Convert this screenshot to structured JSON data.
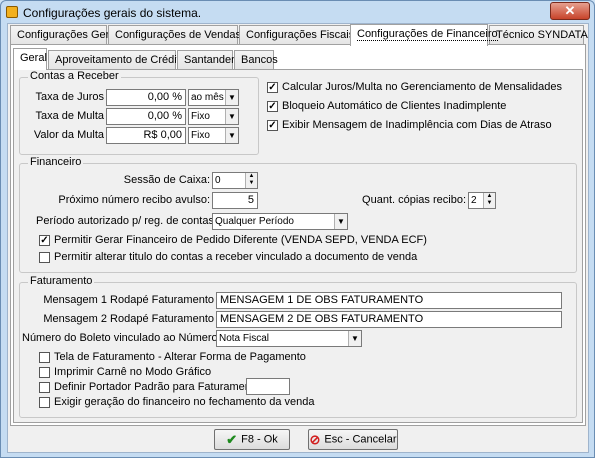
{
  "window": {
    "title": "Configurações gerais do sistema.",
    "close_label": "✕"
  },
  "main_tabs": [
    {
      "label": "Configurações Gerais"
    },
    {
      "label": "Configurações de Vendas"
    },
    {
      "label": "Configurações Fiscais"
    },
    {
      "label": "Configurações de Financeiro"
    },
    {
      "label": "Técnico SYNDATA"
    }
  ],
  "sub_tabs": [
    {
      "label": "Geral"
    },
    {
      "label": "Aproveitamento de Crédito"
    },
    {
      "label": "Santander"
    },
    {
      "label": "Bancos"
    }
  ],
  "contas_receber": {
    "legend": "Contas a Receber",
    "taxa_juros": {
      "label": "Taxa de Juros",
      "value": "0,00 %",
      "unit": "ao mês"
    },
    "taxa_multa": {
      "label": "Taxa de Multa",
      "value": "0,00 %",
      "unit": "Fixo"
    },
    "valor_multa": {
      "label": "Valor da Multa",
      "value": "R$ 0,00",
      "unit": "Fixo"
    }
  },
  "options_right": [
    {
      "label": "Calcular Juros/Multa no Gerenciamento de Mensalidades",
      "checked": true
    },
    {
      "label": "Bloqueio Automático de Clientes Inadimplente",
      "checked": true
    },
    {
      "label": "Exibir Mensagem de Inadimplência com Dias de Atraso",
      "checked": true
    }
  ],
  "financeiro": {
    "legend": "Financeiro",
    "sessao_caixa": {
      "label": "Sessão de Caixa:",
      "value": "0"
    },
    "proximo_recibo": {
      "label": "Próximo número recibo avulso:",
      "value": "5"
    },
    "copias_recibo": {
      "label": "Quant. cópias recibo:",
      "value": "2"
    },
    "periodo": {
      "label": "Período autorizado p/ reg. de contas:",
      "value": "Qualquer Período"
    },
    "check_gerar": {
      "label": "Permitir Gerar Financeiro de Pedido Diferente (VENDA SEPD, VENDA ECF)",
      "checked": true
    },
    "check_alterar": {
      "label": "Permitir alterar titulo do contas a receber vinculado a documento de venda",
      "checked": false
    }
  },
  "faturamento": {
    "legend": "Faturamento",
    "msg1": {
      "label": "Mensagem 1 Rodapé Faturamento",
      "value": "MENSAGEM 1 DE OBS FATURAMENTO"
    },
    "msg2": {
      "label": "Mensagem 2 Rodapé Faturamento",
      "value": "MENSAGEM 2 DE OBS FATURAMENTO"
    },
    "boleto": {
      "label": "Número do Boleto vinculado ao Número",
      "value": "Nota Fiscal"
    },
    "check_tela": {
      "label": "Tela de Faturamento - Alterar Forma de Pagamento",
      "checked": false
    },
    "check_carne": {
      "label": "Imprimir Carnê no Modo Gráfico",
      "checked": false
    },
    "check_portador": {
      "label": "Definir Portador Padrão para Faturamento :",
      "checked": false,
      "value": ""
    },
    "check_exigir": {
      "label": "Exigir geração do financeiro no fechamento da venda",
      "checked": false
    }
  },
  "buttons": {
    "ok": {
      "label": "F8 - Ok",
      "icon": "check-icon",
      "color": "#1e8a1e"
    },
    "cancel": {
      "label": "Esc - Cancelar",
      "icon": "cancel-icon",
      "color": "#d21f1f"
    }
  }
}
